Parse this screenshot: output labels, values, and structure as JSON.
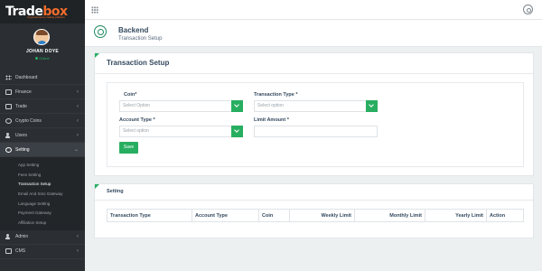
{
  "brand": {
    "logo_primary": "Trade",
    "logo_accent": "box",
    "tagline": "Cryptocurrency trading platform",
    "accent": "#f26c2a"
  },
  "profile": {
    "name": "JOHAN DOYE",
    "status": "Online"
  },
  "sidebar": {
    "items": [
      {
        "label": "Dashboard",
        "icon": "dashboard-icon"
      },
      {
        "label": "Finance",
        "icon": "card-icon",
        "chevron": "‹"
      },
      {
        "label": "Trade",
        "icon": "card-icon",
        "chevron": "‹"
      },
      {
        "label": "Crypto Coins",
        "icon": "coin-icon",
        "chevron": "‹"
      },
      {
        "label": "Users",
        "icon": "users-icon",
        "chevron": "‹"
      },
      {
        "label": "Setting",
        "icon": "gear-icon",
        "chevron": "⌄"
      }
    ],
    "sub_items": [
      "App Setting",
      "Fees Setting",
      "Transaction Setup",
      "Email And Sms Gateway",
      "Language Setting",
      "Payment Gateway",
      "Affiliation Setup"
    ],
    "bottom_items": [
      {
        "label": "Admin",
        "icon": "users-icon",
        "chevron": "‹"
      },
      {
        "label": "CMS",
        "icon": "card-icon",
        "chevron": "‹"
      }
    ]
  },
  "header": {
    "title": "Backend",
    "subtitle": "Transaction Setup"
  },
  "form_panel": {
    "title": "Transaction Setup",
    "coin_label": "Coin*",
    "coin_placeholder": "Select Option",
    "transaction_type_label": "Transaction Type *",
    "transaction_type_placeholder": "Select option",
    "account_type_label": "Account Type *",
    "account_type_placeholder": "Select option",
    "limit_amount_label": "Limit Amount *",
    "limit_amount_value": "",
    "save_label": "Save"
  },
  "table_panel": {
    "title": "Setting",
    "columns": [
      "Transaction Type",
      "Account Type",
      "Coin",
      "Weekly Limit",
      "Monthly Limit",
      "Yearly Limit",
      "Action"
    ]
  },
  "colors": {
    "primary": "#27ae60",
    "sidebar": "#2b2f33",
    "heading": "#34495e"
  }
}
